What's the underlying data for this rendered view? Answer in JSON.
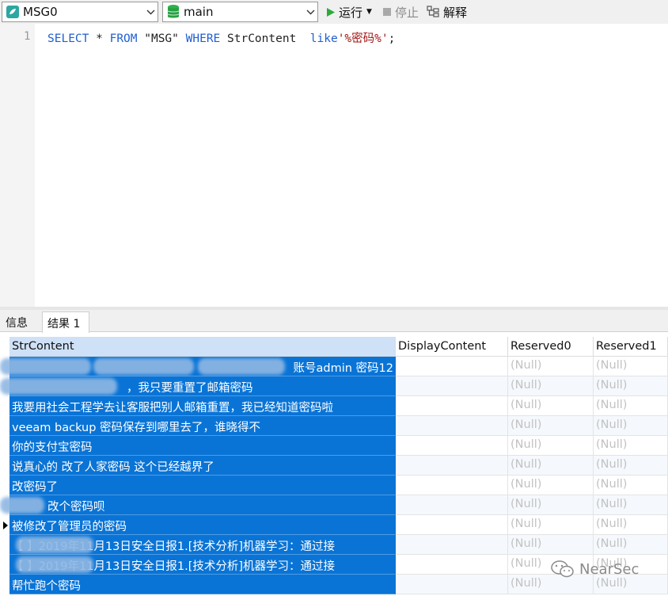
{
  "toolbar": {
    "connection": "MSG0",
    "database": "main",
    "run_label": "运行",
    "stop_label": "停止",
    "explain_label": "解释"
  },
  "editor": {
    "line_number": "1",
    "sql_tokens": [
      {
        "text": "SELECT",
        "kind": "kw"
      },
      {
        "text": " * ",
        "kind": "plain"
      },
      {
        "text": "FROM",
        "kind": "kw"
      },
      {
        "text": " \"MSG\" ",
        "kind": "plain"
      },
      {
        "text": "WHERE",
        "kind": "kw"
      },
      {
        "text": " StrContent  ",
        "kind": "plain"
      },
      {
        "text": "like",
        "kind": "kw"
      },
      {
        "text": "'%密码%'",
        "kind": "str"
      },
      {
        "text": ";",
        "kind": "plain"
      }
    ]
  },
  "tabs": {
    "info": "信息",
    "result": "结果 1"
  },
  "grid": {
    "columns": [
      "StrContent",
      "DisplayContent",
      "Reserved0",
      "Reserved1"
    ],
    "null_text": "(Null)",
    "rows": [
      {
        "str": "账号admin  密码12",
        "display": "",
        "r0": "(Null)",
        "r1": "(Null)"
      },
      {
        "str": "，我只要重置了邮箱密码",
        "display": "",
        "r0": "(Null)",
        "r1": "(Null)"
      },
      {
        "str": "我要用社会工程学去让客服把别人邮箱重置，我已经知道密码啦",
        "display": "",
        "r0": "(Null)",
        "r1": "(Null)"
      },
      {
        "str": "veeam backup  密码保存到哪里去了，谁晓得不",
        "display": "",
        "r0": "(Null)",
        "r1": "(Null)"
      },
      {
        "str": "你的支付宝密码",
        "display": "",
        "r0": "(Null)",
        "r1": "(Null)"
      },
      {
        "str": "说真心的  改了人家密码   这个已经越界了",
        "display": "",
        "r0": "(Null)",
        "r1": "(Null)"
      },
      {
        "str": "改密码了",
        "display": "",
        "r0": "(Null)",
        "r1": "(Null)"
      },
      {
        "str": "改个密码呗",
        "display": "",
        "r0": "(Null)",
        "r1": "(Null)"
      },
      {
        "str": "被修改了管理员的密码",
        "display": "",
        "r0": "(Null)",
        "r1": "(Null)"
      },
      {
        "str": "【                 】2019年11月13日安全日报1.[技术分析]机器学习：通过接",
        "display": "",
        "r0": "(Null)",
        "r1": "(Null)"
      },
      {
        "str": "【                 】2019年11月13日安全日报1.[技术分析]机器学习：通过接",
        "display": "",
        "r0": "(Null)",
        "r1": "(Null)"
      },
      {
        "str": "帮忙跑个密码",
        "display": "",
        "r0": "(Null)",
        "r1": "(Null)"
      }
    ]
  },
  "watermark": "NearSec",
  "colors": {
    "selection": "#0a74d6",
    "keyword": "#1f5fd0",
    "string": "#a31515"
  }
}
